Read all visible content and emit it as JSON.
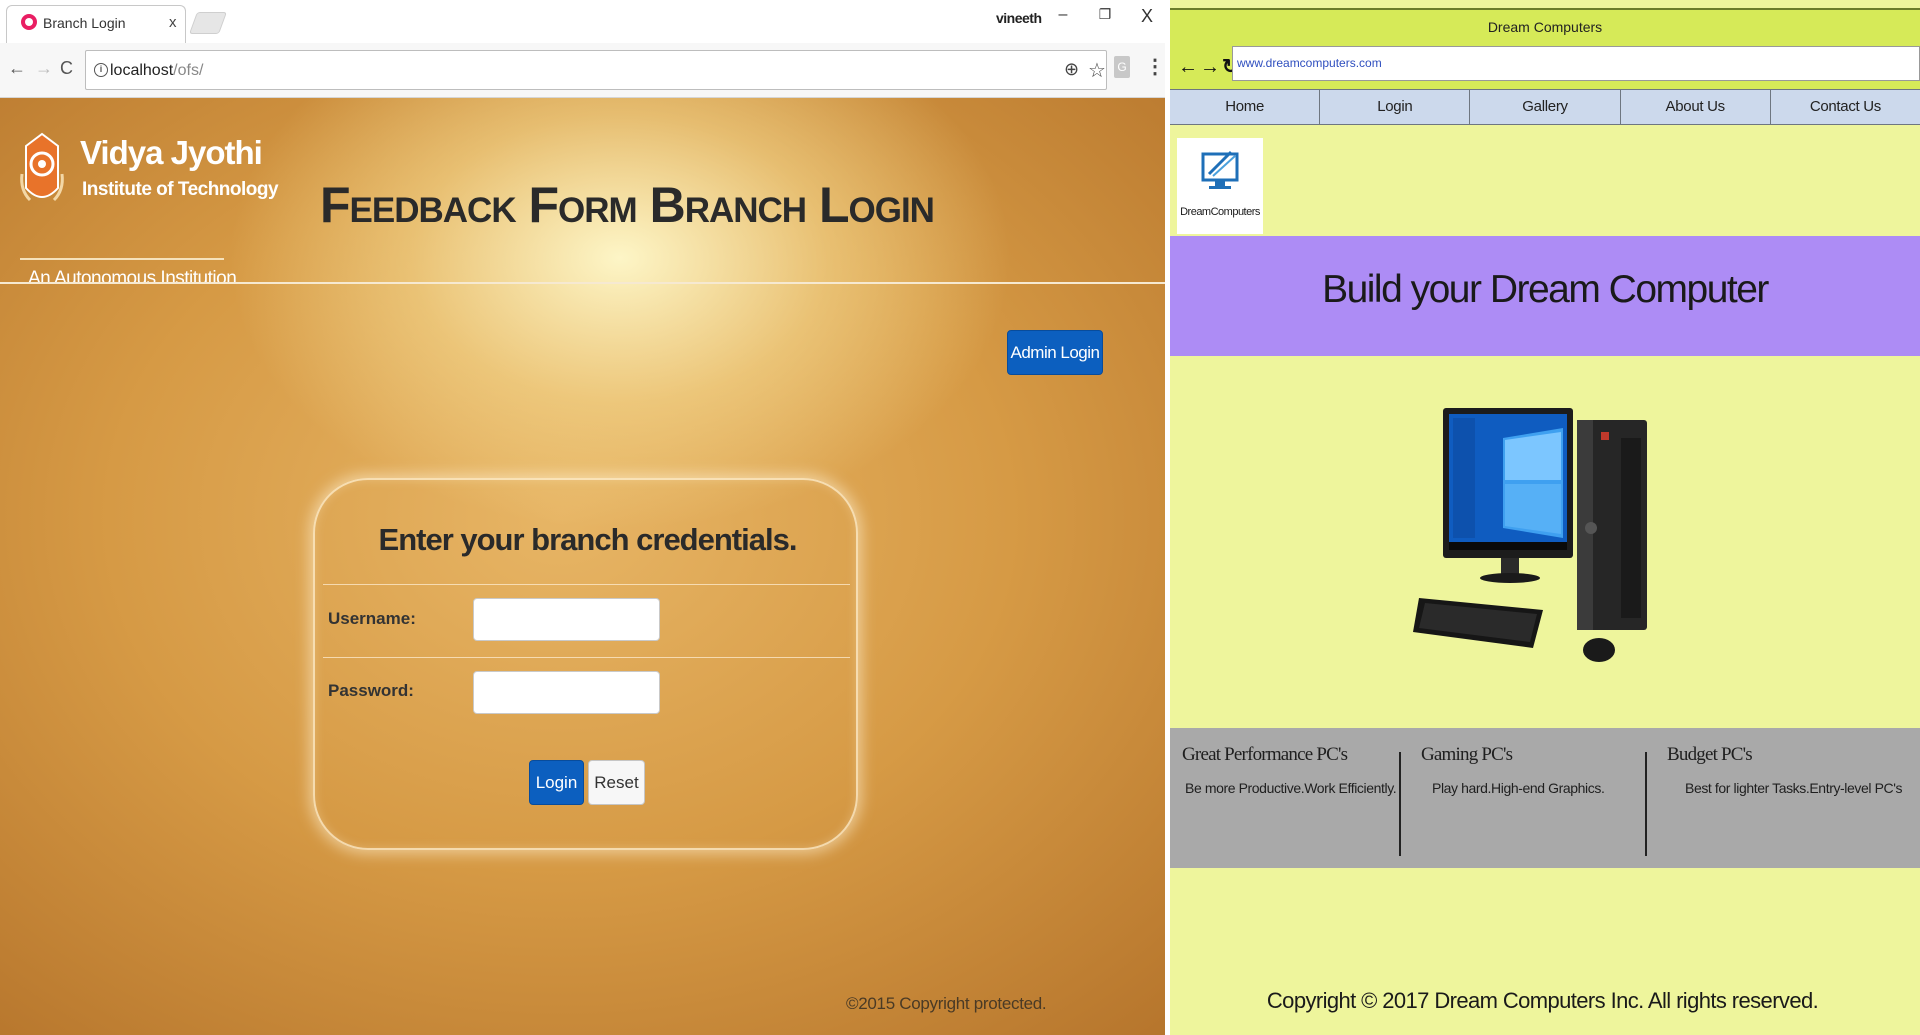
{
  "browser": {
    "tab_title": "Branch Login",
    "tab_close": "x",
    "profile_name": "vineeth",
    "win_minimize": "–",
    "win_maximize": "❐",
    "win_close": "X",
    "back_icon": "←",
    "forward_icon": "→",
    "reload_icon": "C",
    "url_host": "localhost",
    "url_path": "/ofs/",
    "info_icon": "i",
    "zoom_icon": "⊕",
    "star_icon": "☆",
    "extension_label": "G",
    "menu_icon": "⋮"
  },
  "page": {
    "logo_name": "Vidya Jyothi",
    "logo_sub": "Institute of Technology",
    "logo_tagline": "An Autonomous Institution",
    "title": "Feedback Form Branch Login",
    "admin_login": "Admin Login",
    "card_heading": "Enter your branch credentials.",
    "username_label": "Username:",
    "password_label": "Password:",
    "username_value": "",
    "password_value": "",
    "login_button": "Login",
    "reset_button": "Reset",
    "copyright": "©2015 Copyright protected."
  },
  "mockup": {
    "window_title": "Dream Computers",
    "nav_icons": "←→↻",
    "url": "www.dreamcomputers.com",
    "menu": [
      "Home",
      "Login",
      "Gallery",
      "About Us",
      "Contact Us"
    ],
    "logo_text": "DreamComputers",
    "hero": "Build your Dream Computer",
    "features": [
      {
        "title": "Great Performance PC's",
        "desc": "Be more Productive.Work Efficiently."
      },
      {
        "title": "Gaming PC's",
        "desc": "Play hard.High-end Graphics."
      },
      {
        "title": "Budget PC's",
        "desc": "Best for lighter Tasks.Entry-level PC's"
      }
    ],
    "footer": "Copyright © 2017 Dream Computers Inc. All rights reserved."
  },
  "colors": {
    "brand_button": "#0c5fbf",
    "mockup_bg": "#eef59c",
    "mockup_bar": "#d6ea58",
    "mockup_hero": "#ad8cf5",
    "mockup_features": "#a9a9a9"
  }
}
